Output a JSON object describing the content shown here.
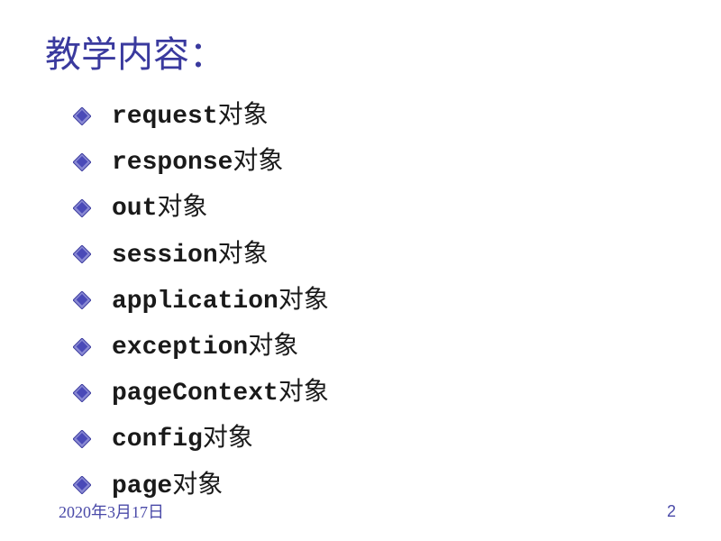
{
  "title": "教学内容：",
  "items": [
    {
      "mono": "request",
      "cjk": "对象"
    },
    {
      "mono": "response",
      "cjk": "对象"
    },
    {
      "mono": "out",
      "cjk": "对象"
    },
    {
      "mono": "session",
      "cjk": "对象"
    },
    {
      "mono": "application",
      "cjk": "对象"
    },
    {
      "mono": "exception",
      "cjk": "对象"
    },
    {
      "mono": "pageContext",
      "cjk": "对象"
    },
    {
      "mono": "config",
      "cjk": "对象"
    },
    {
      "mono": "page",
      "cjk": "对象"
    }
  ],
  "footer": {
    "date": "2020年3月17日",
    "page": "2"
  }
}
